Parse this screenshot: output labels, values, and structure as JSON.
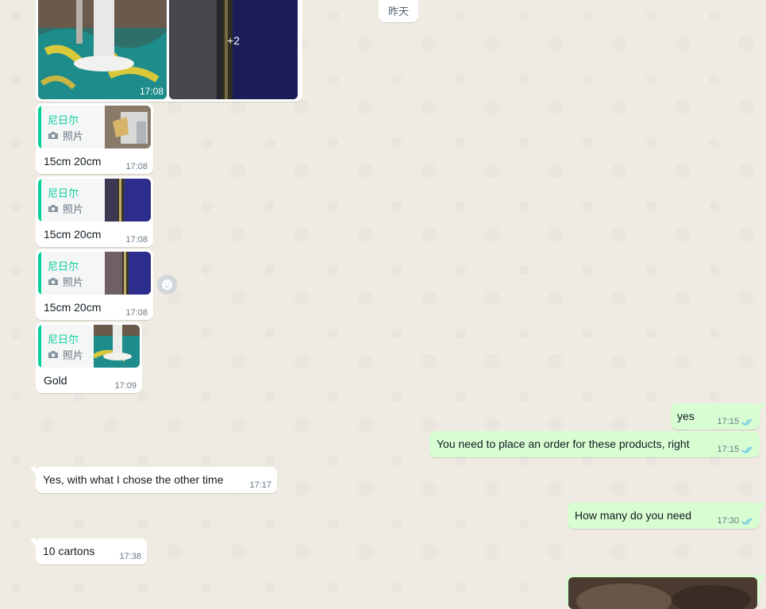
{
  "date_divider": "昨天",
  "album": {
    "time": "17:08",
    "more_count": "+2",
    "photos": [
      "sea-lamp-photo",
      "dark-pole-photo"
    ]
  },
  "incoming_quoted": [
    {
      "author": "尼日尔",
      "type_label": "照片",
      "text": "15cm 20cm",
      "time": "17:08"
    },
    {
      "author": "尼日尔",
      "type_label": "照片",
      "text": "15cm 20cm",
      "time": "17:08"
    },
    {
      "author": "尼日尔",
      "type_label": "照片",
      "text": "15cm 20cm",
      "time": "17:08"
    },
    {
      "author": "尼日尔",
      "type_label": "照片",
      "text": "Gold",
      "time": "17:09"
    }
  ],
  "messages": {
    "out_yes": {
      "text": "yes",
      "time": "17:15"
    },
    "out_order": {
      "text": "You need to place an order for these products, right",
      "time": "17:15"
    },
    "in_chose": {
      "text": "Yes, with what I chose the other time",
      "time": "17:17"
    },
    "out_how_many": {
      "text": "How many do you need",
      "time": "17:30"
    },
    "in_cartons": {
      "text": "10 cartons",
      "time": "17:38"
    }
  },
  "colors": {
    "chat_bg": "#efeae2",
    "incoming_bubble": "#ffffff",
    "outgoing_bubble": "#d9fdd3",
    "quote_accent": "#06cf9c",
    "read_ticks": "#53bdeb"
  }
}
